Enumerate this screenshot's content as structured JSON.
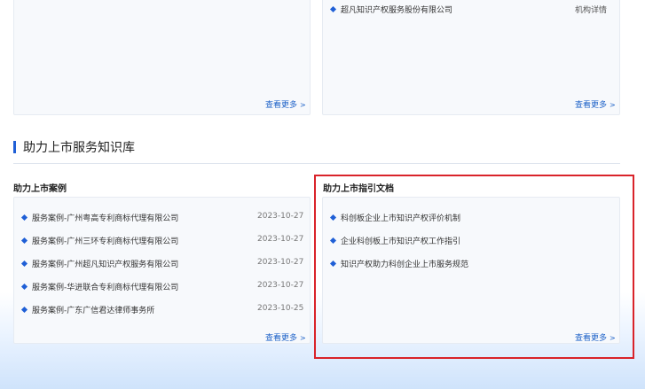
{
  "top_cards": {
    "right_row": {
      "title": "超凡知识产权服务股份有限公司",
      "link": "机构详情"
    },
    "left_more": "查看更多",
    "right_more": "查看更多"
  },
  "section": {
    "title": "助力上市服务知识库"
  },
  "cases": {
    "title": "助力上市案例",
    "items": [
      {
        "title": "服务案例-广州粤高专利商标代理有限公司",
        "date": "2023-10-27"
      },
      {
        "title": "服务案例-广州三环专利商标代理有限公司",
        "date": "2023-10-27"
      },
      {
        "title": "服务案例-广州超凡知识产权服务有限公司",
        "date": "2023-10-27"
      },
      {
        "title": "服务案例-华进联合专利商标代理有限公司",
        "date": "2023-10-27"
      },
      {
        "title": "服务案例-广东广信君达律师事务所",
        "date": "2023-10-25"
      }
    ],
    "more": "查看更多"
  },
  "guides": {
    "title": "助力上市指引文档",
    "items": [
      {
        "title": "科创板企业上市知识产权评价机制"
      },
      {
        "title": "企业科创板上市知识产权工作指引"
      },
      {
        "title": "知识产权助力科创企业上市服务规范"
      }
    ],
    "more": "查看更多"
  },
  "colors": {
    "accent": "#1f5fd6",
    "highlight_border": "#d9232a"
  }
}
